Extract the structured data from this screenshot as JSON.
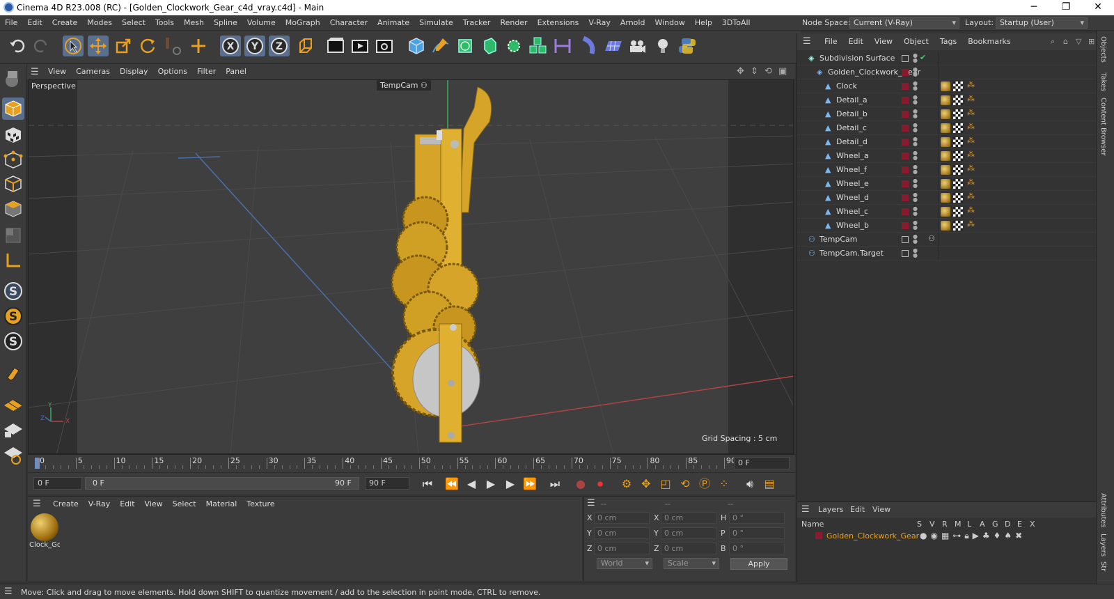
{
  "window": {
    "title": "Cinema 4D R23.008 (RC) - [Golden_Clockwork_Gear_c4d_vray.c4d] - Main",
    "minimize": "─",
    "restore": "❐",
    "close": "✕"
  },
  "menu": [
    "File",
    "Edit",
    "Create",
    "Modes",
    "Select",
    "Tools",
    "Mesh",
    "Spline",
    "Volume",
    "MoGraph",
    "Character",
    "Animate",
    "Simulate",
    "Tracker",
    "Render",
    "Extensions",
    "V-Ray",
    "Arnold",
    "Window",
    "Help",
    "3DToAll"
  ],
  "nodespace": {
    "label": "Node Space:",
    "value": "Current (V-Ray)"
  },
  "layout": {
    "label": "Layout:",
    "value": "Startup (User)"
  },
  "viewport": {
    "menu": [
      "View",
      "Cameras",
      "Display",
      "Options",
      "Filter",
      "Panel"
    ],
    "name": "Perspective",
    "camera": "TempCam",
    "grid_spacing": "Grid Spacing : 5 cm",
    "axis_x": "X",
    "axis_y": "Y",
    "axis_z": "Z"
  },
  "timeline": {
    "ticks": [
      "0",
      "5",
      "10",
      "15",
      "20",
      "25",
      "30",
      "35",
      "40",
      "45",
      "50",
      "55",
      "60",
      "65",
      "70",
      "75",
      "80",
      "85",
      "90"
    ],
    "current": "0 F"
  },
  "transport": {
    "start": "0 F",
    "range_start": "0 F",
    "range_end": "90 F",
    "end": "90 F"
  },
  "material": {
    "menu": [
      "Create",
      "V-Ray",
      "Edit",
      "View",
      "Select",
      "Material",
      "Texture"
    ],
    "items": [
      {
        "name": "Clock_Gc"
      }
    ]
  },
  "coord": {
    "header": [
      "--",
      "--",
      "--"
    ],
    "rows": [
      {
        "a": "X",
        "av": "0 cm",
        "b": "X",
        "bv": "0 cm",
        "c": "H",
        "cv": "0 °"
      },
      {
        "a": "Y",
        "av": "0 cm",
        "b": "Y",
        "bv": "0 cm",
        "c": "P",
        "cv": "0 °"
      },
      {
        "a": "Z",
        "av": "0 cm",
        "b": "Z",
        "bv": "0 cm",
        "c": "B",
        "cv": "0 °"
      }
    ],
    "mode": "World",
    "scale": "Scale",
    "apply": "Apply"
  },
  "objects": {
    "menu": [
      "File",
      "Edit",
      "View",
      "Object",
      "Tags",
      "Bookmarks"
    ],
    "rows": [
      {
        "name": "Subdivision Surface",
        "level": 0
      },
      {
        "name": "Golden_Clockwork_Gear",
        "level": 1
      },
      {
        "name": "Clock",
        "level": 2
      },
      {
        "name": "Detail_a",
        "level": 2
      },
      {
        "name": "Detail_b",
        "level": 2
      },
      {
        "name": "Detail_c",
        "level": 2
      },
      {
        "name": "Detail_d",
        "level": 2
      },
      {
        "name": "Wheel_a",
        "level": 2
      },
      {
        "name": "Wheel_f",
        "level": 2
      },
      {
        "name": "Wheel_e",
        "level": 2
      },
      {
        "name": "Wheel_d",
        "level": 2
      },
      {
        "name": "Wheel_c",
        "level": 2
      },
      {
        "name": "Wheel_b",
        "level": 2
      },
      {
        "name": "TempCam",
        "level": 0
      },
      {
        "name": "TempCam.Target",
        "level": 0
      }
    ]
  },
  "layers": {
    "menu": [
      "Layers",
      "Edit",
      "View"
    ],
    "header_name": "Name",
    "flags": [
      "S",
      "V",
      "R",
      "M",
      "L",
      "A",
      "G",
      "D",
      "E",
      "X"
    ],
    "items": [
      {
        "name": "Golden_Clockwork_Gear",
        "color": "#8b1a2e"
      }
    ]
  },
  "righttabs": [
    "Objects",
    "Takes",
    "Content Browser",
    "Attributes",
    "Layers",
    "Str"
  ],
  "status": "Move: Click and drag to move elements. Hold down SHIFT to quantize movement / add to the selection in point mode, CTRL to remove.",
  "colors": {
    "accent": "#5a6f8e",
    "gold": "#d6a429",
    "layer": "#8b1a2e"
  }
}
